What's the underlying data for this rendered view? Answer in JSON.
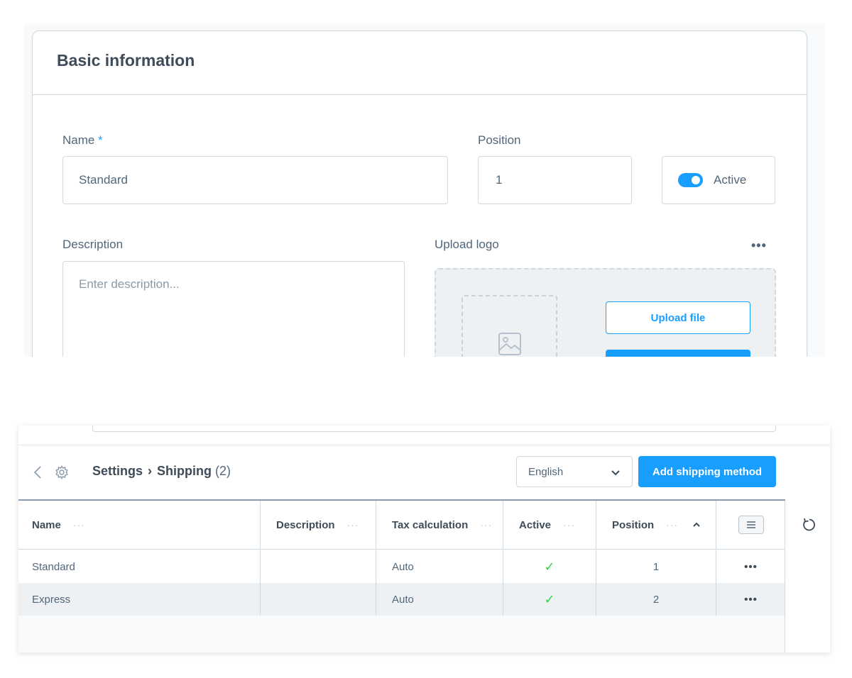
{
  "form": {
    "title": "Basic information",
    "name_label": "Name",
    "required_mark": "*",
    "name_value": "Standard",
    "position_label": "Position",
    "position_value": "1",
    "active_label": "Active",
    "active_on": true,
    "description_label": "Description",
    "description_placeholder": "Enter description...",
    "upload_label": "Upload logo",
    "upload_more": "•••",
    "upload_file_button": "Upload file"
  },
  "toolbar": {
    "breadcrumb_parent": "Settings",
    "breadcrumb_separator": "›",
    "breadcrumb_current": "Shipping",
    "breadcrumb_count": "(2)",
    "language_selected": "English",
    "add_button": "Add shipping method"
  },
  "table": {
    "columns": [
      {
        "label": "Name",
        "menu": "···"
      },
      {
        "label": "Description",
        "menu": "···"
      },
      {
        "label": "Tax calculation",
        "menu": "···"
      },
      {
        "label": "Active",
        "menu": "···"
      },
      {
        "label": "Position",
        "menu": "···"
      }
    ],
    "rows": [
      {
        "name": "Standard",
        "description": "",
        "tax": "Auto",
        "active": true,
        "position": "1",
        "actions": "•••"
      },
      {
        "name": "Express",
        "description": "",
        "tax": "Auto",
        "active": true,
        "position": "2",
        "actions": "•••"
      }
    ],
    "check_glyph": "✓"
  },
  "colors": {
    "accent": "#189eff",
    "text": "#52667a",
    "heading": "#3e4b58",
    "border": "#d1d9e0",
    "success": "#37d046"
  },
  "icons": {
    "back": "chevron-left-icon",
    "settings": "gear-icon",
    "dropdown": "chevron-down-icon",
    "sort": "chevron-up-icon",
    "column_settings": "menu-lines-icon",
    "reset": "refresh-icon",
    "image": "image-icon"
  }
}
